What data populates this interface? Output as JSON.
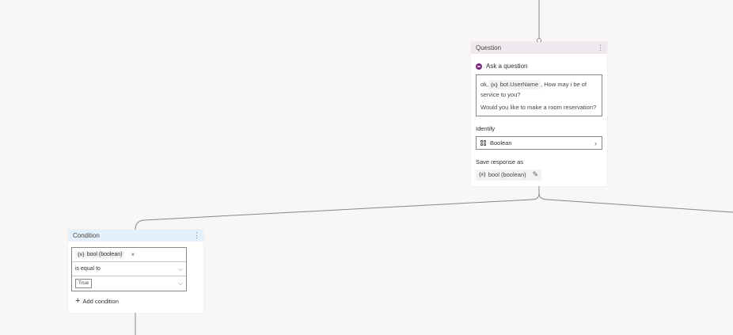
{
  "question_node": {
    "title": "Question",
    "menu_icon": "more-vertical-icon",
    "ask_label": "Ask a question",
    "message": {
      "prefix": "ok,",
      "variable_icon": "{x}",
      "variable": "bot.UserName",
      "suffix": ", How may i be of",
      "line2": "service to you?",
      "line3": "Would you like to make a room reservation?"
    },
    "identify_label": "Identify",
    "identify_value": "Boolean",
    "save_label": "Save response as",
    "save_variable_icon": "{x}",
    "save_variable": "bool (boolean)"
  },
  "condition_node": {
    "title": "Condition",
    "menu_icon": "more-vertical-icon",
    "variable_icon": "{x}",
    "variable": "bool (boolean)",
    "remove_glyph": "×",
    "operator": "is equal to",
    "value": "True",
    "add_label": "Add condition"
  },
  "colors": {
    "canvas": "#f8f7f6",
    "question_header": "#efe9ef",
    "condition_header": "#e4f0fb",
    "accent": "#7b2a7a"
  }
}
